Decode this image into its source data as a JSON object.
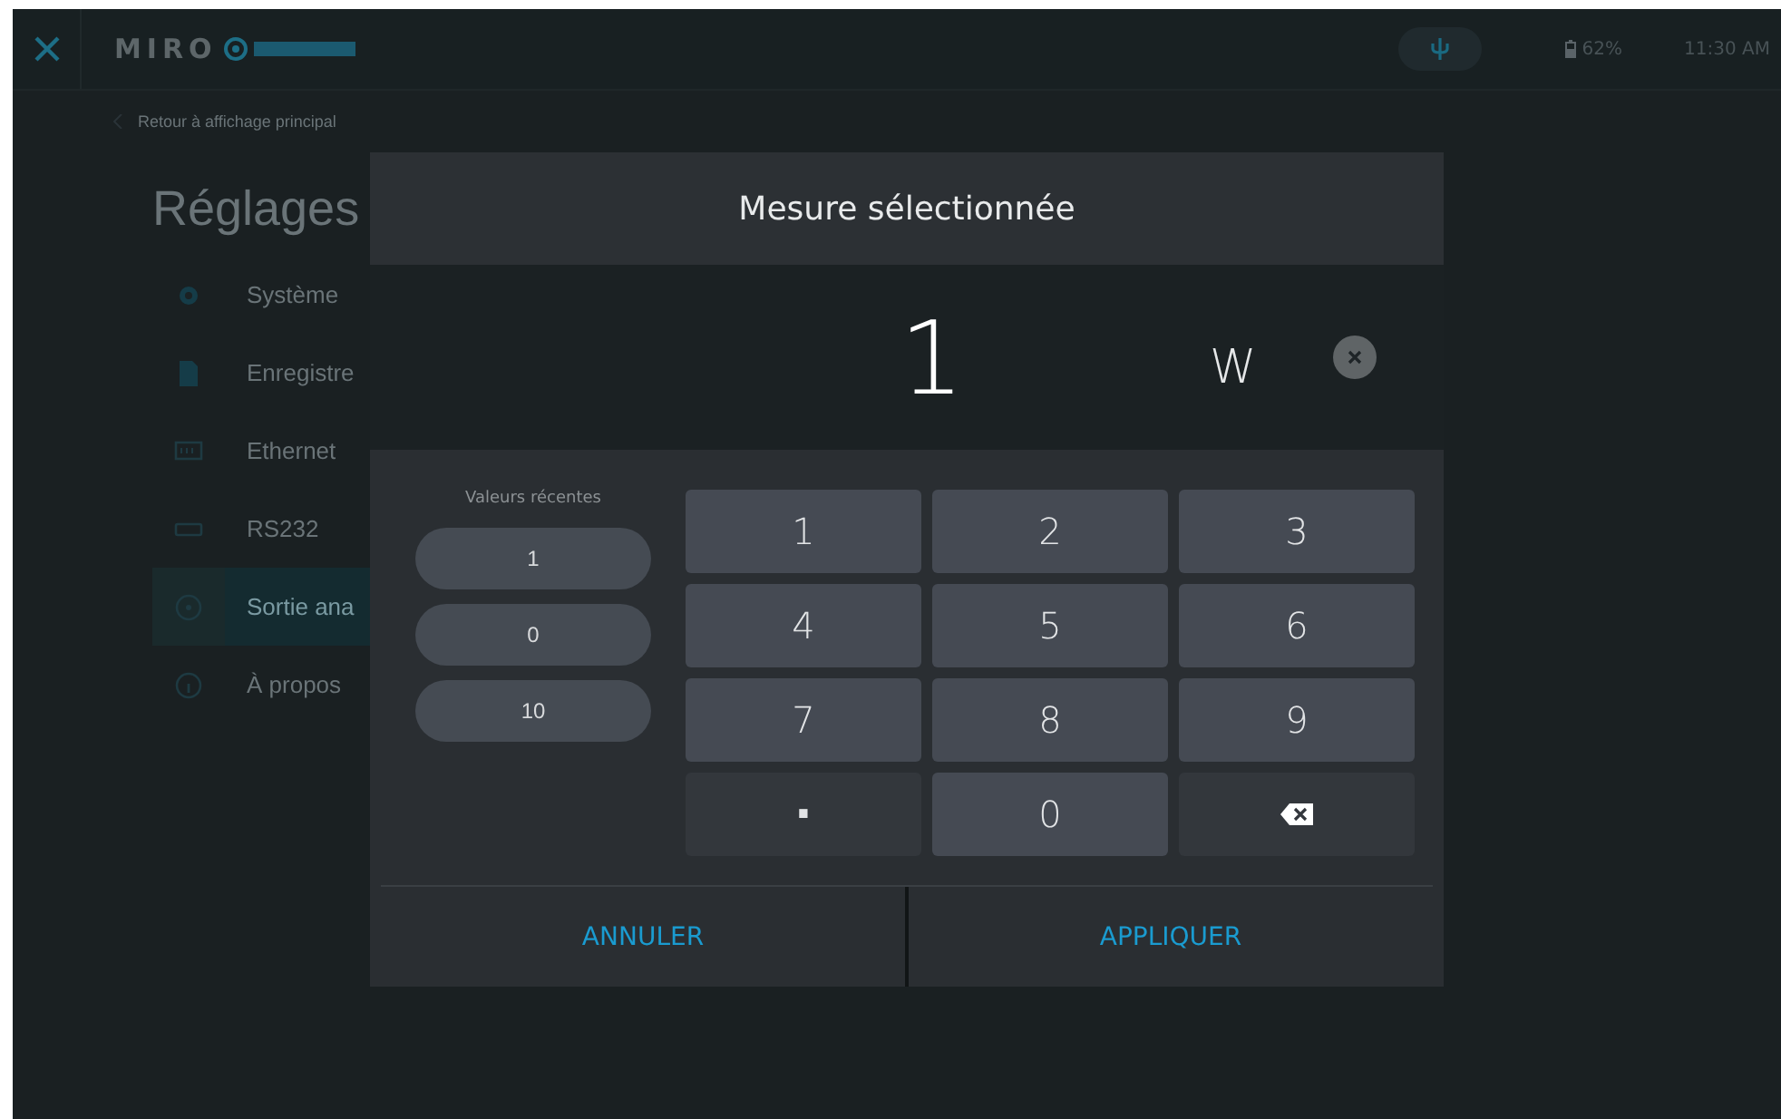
{
  "top_bar": {
    "logo": "MIRO",
    "battery": "62%",
    "time": "11:30 AM"
  },
  "breadcrumb": "Retour à affichage principal",
  "page_title": "Réglages",
  "sidebar": {
    "items": [
      {
        "label": "Système",
        "selected": false
      },
      {
        "label": "Enregistre",
        "selected": false
      },
      {
        "label": "Ethernet",
        "selected": false
      },
      {
        "label": "RS232",
        "selected": false
      },
      {
        "label": "Sortie ana",
        "selected": true
      },
      {
        "label": "À propos",
        "selected": false
      }
    ]
  },
  "dialog": {
    "title": "Mesure sélectionnée",
    "value": "1",
    "unit": "W",
    "recent": {
      "label": "Valeurs récentes",
      "values": [
        "1",
        "0",
        "10"
      ]
    },
    "keys": [
      {
        "kind": "digit",
        "label": "1"
      },
      {
        "kind": "digit",
        "label": "2"
      },
      {
        "kind": "digit",
        "label": "3"
      },
      {
        "kind": "digit",
        "label": "4"
      },
      {
        "kind": "digit",
        "label": "5"
      },
      {
        "kind": "digit",
        "label": "6"
      },
      {
        "kind": "digit",
        "label": "7"
      },
      {
        "kind": "digit",
        "label": "8"
      },
      {
        "kind": "digit",
        "label": "9"
      },
      {
        "kind": "dot",
        "label": "."
      },
      {
        "kind": "digit",
        "label": "0"
      },
      {
        "kind": "backspace"
      }
    ],
    "buttons": [
      "ANNULER",
      "APPLIQUER"
    ]
  }
}
